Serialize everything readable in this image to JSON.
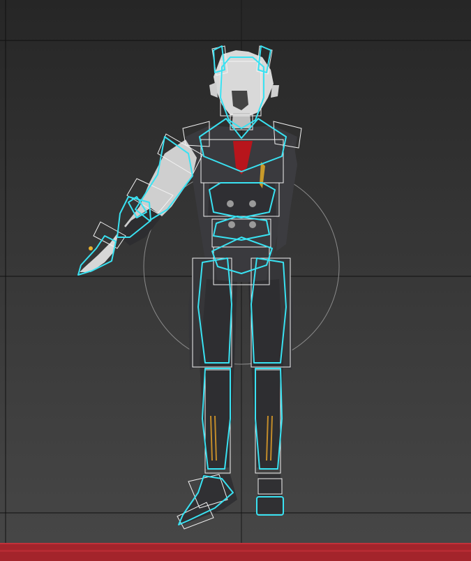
{
  "viewport": {
    "kind": "3d-perspective-viewport",
    "background_top": "#262626",
    "background_bottom": "#474747",
    "grid_color": "#0c0c0c",
    "home_grid_line_color": "#151515"
  },
  "scene": {
    "subject": "rigged-character-model",
    "rig_control_color": "#39e2f2",
    "bone_box_color": "#f2f2f2",
    "gizmo_ring_color": "#8a8a8a"
  },
  "status_bar": {
    "color": "#a3242b"
  }
}
